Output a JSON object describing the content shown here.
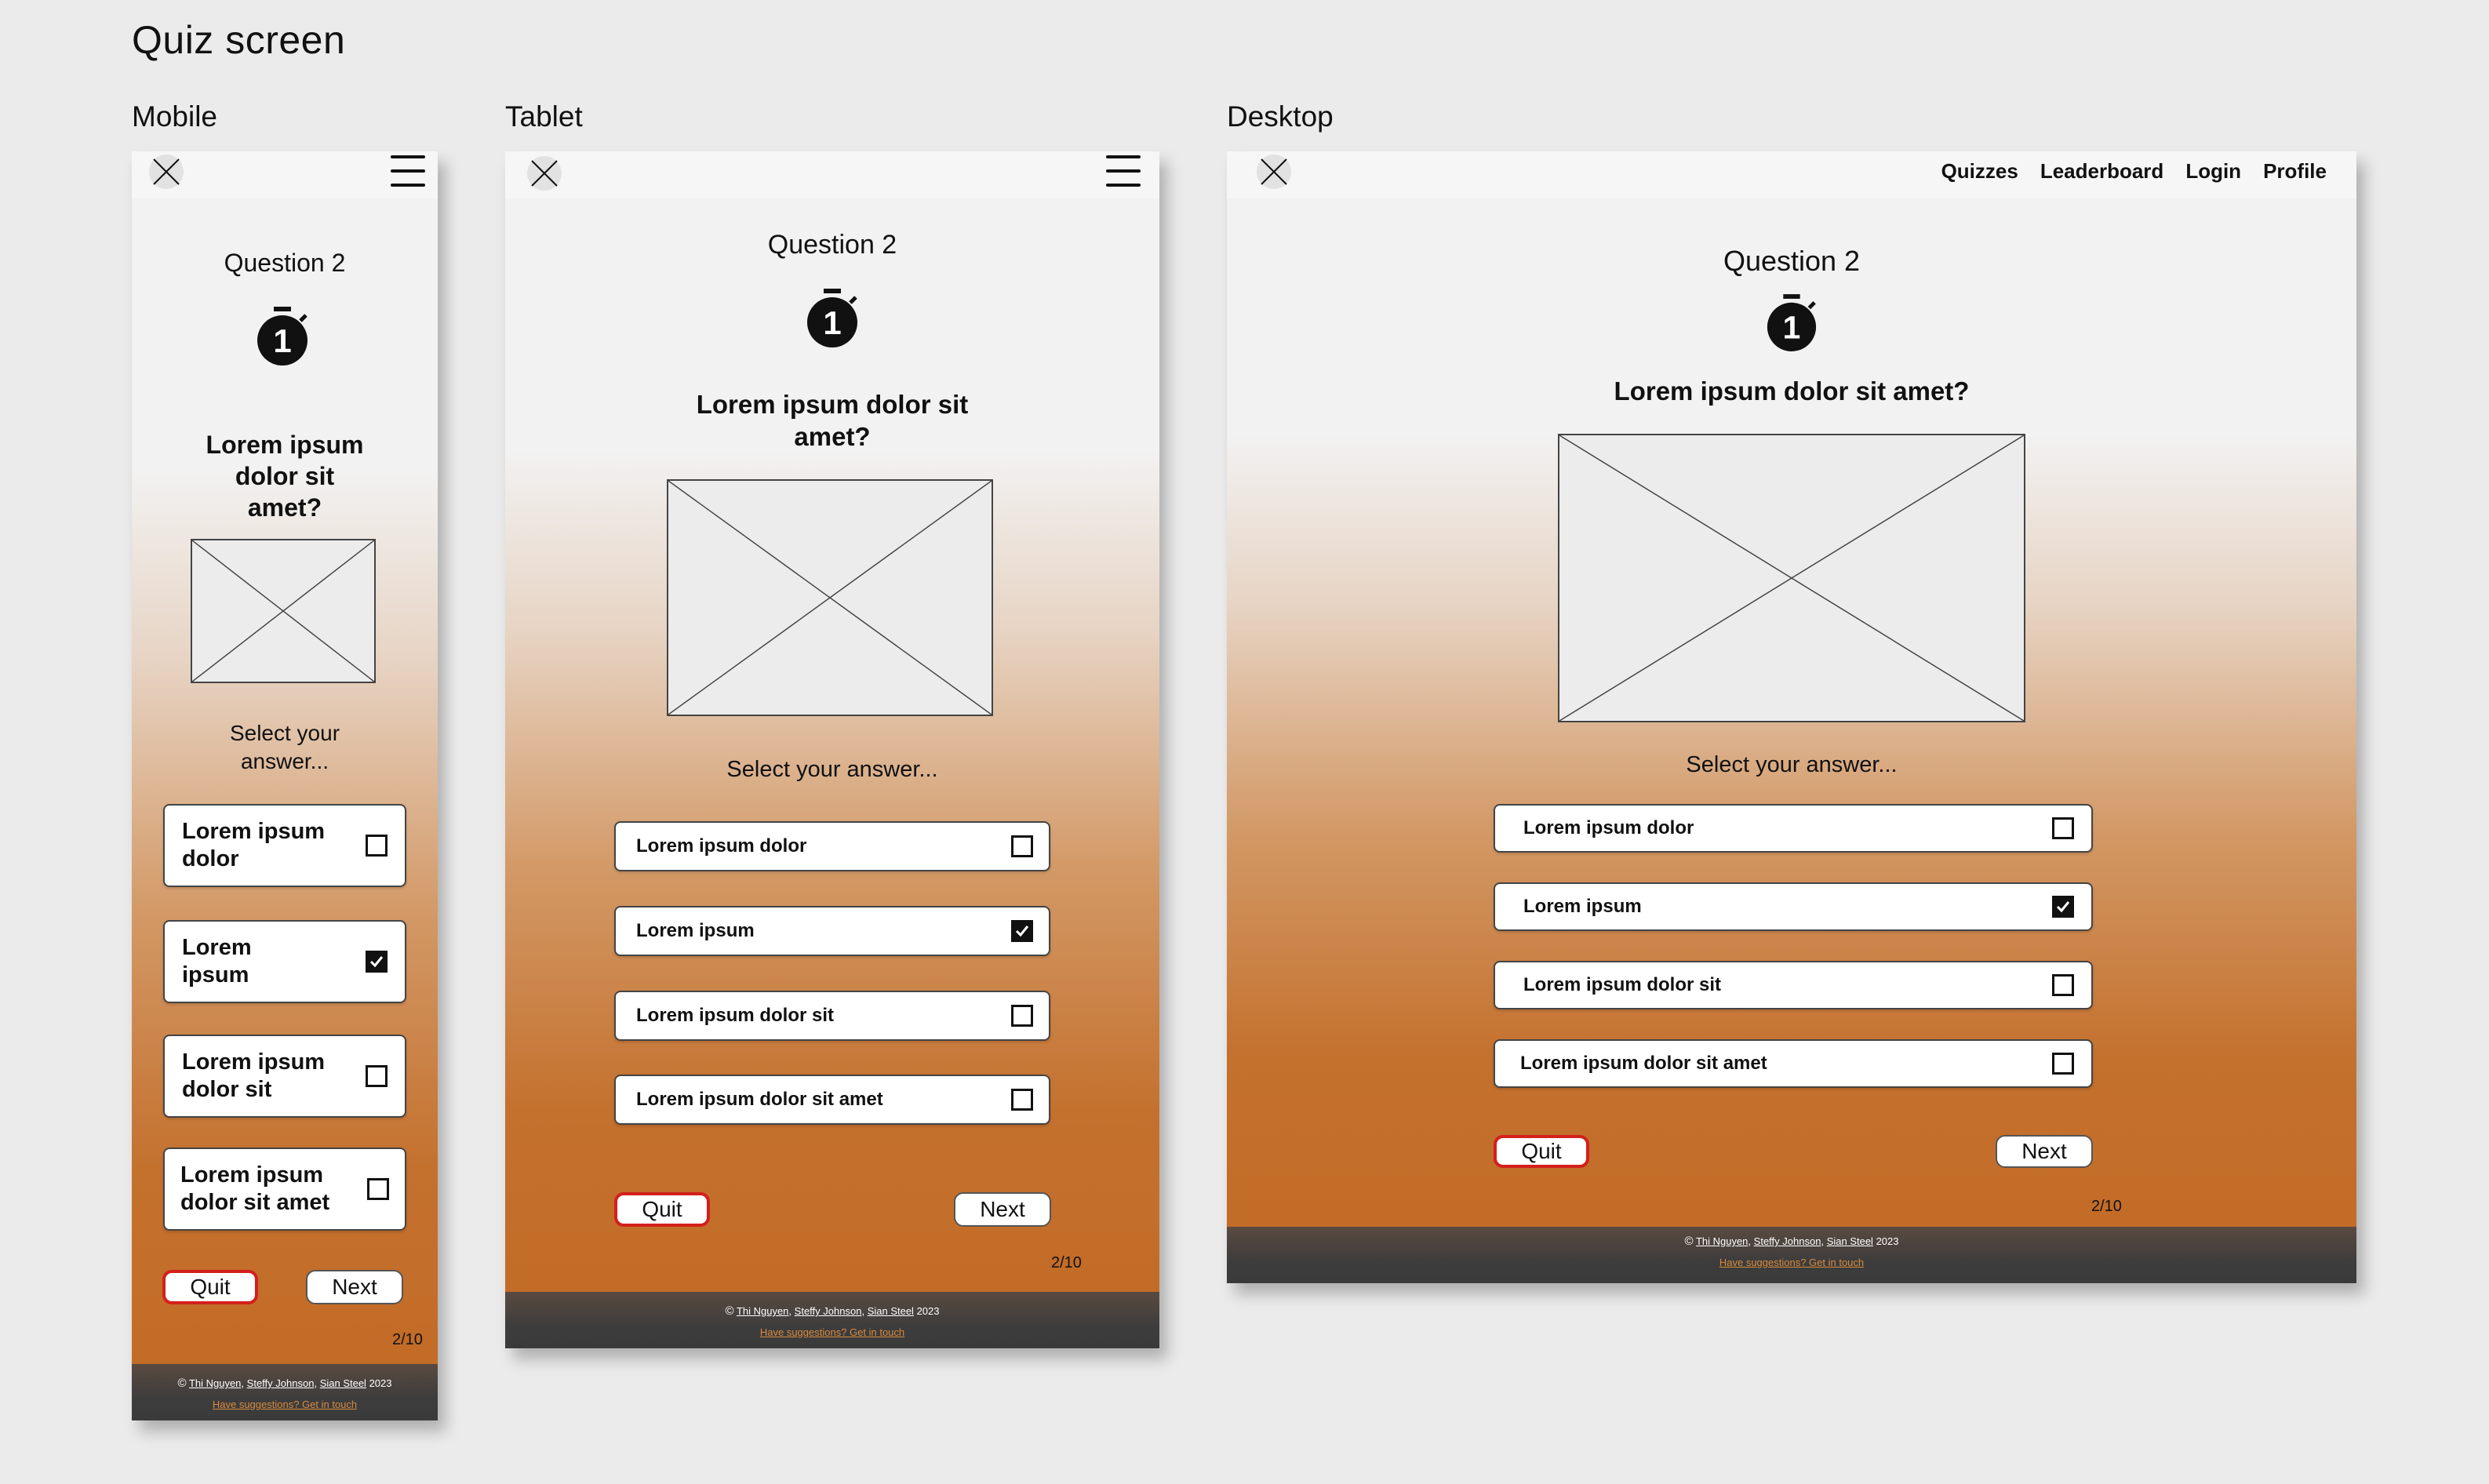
{
  "page": {
    "title": "Quiz screen"
  },
  "labels": {
    "mobile": "Mobile",
    "tablet": "Tablet",
    "desktop": "Desktop"
  },
  "nav": {
    "quizzes": "Quizzes",
    "leaderboard": "Leaderboard",
    "login": "Login",
    "profile": "Profile"
  },
  "quiz": {
    "question_number": "Question 2",
    "timer": "1",
    "question": "Lorem ipsum dolor sit amet?",
    "prompt": "Select your answer...",
    "options": [
      {
        "label": "Lorem ipsum dolor",
        "checked": false
      },
      {
        "label": "Lorem ipsum",
        "checked": true
      },
      {
        "label": "Lorem ipsum dolor sit",
        "checked": false
      },
      {
        "label": "Lorem ipsum dolor sit amet",
        "checked": false
      }
    ],
    "quit": "Quit",
    "next": "Next",
    "progress": "2/10"
  },
  "footer": {
    "copyright_symbol": "©",
    "author1": "Thi Nguyen",
    "sep1": ",",
    "author2": "Steffy Johnson",
    "sep2": ",",
    "author3": "Sian Steel",
    "year": "2023",
    "contact": "Have suggestions? Get in touch"
  },
  "colors": {
    "accent_orange": "#c26a25",
    "quit_border": "#d3201b",
    "footer_dark": "#3a3a3a"
  }
}
